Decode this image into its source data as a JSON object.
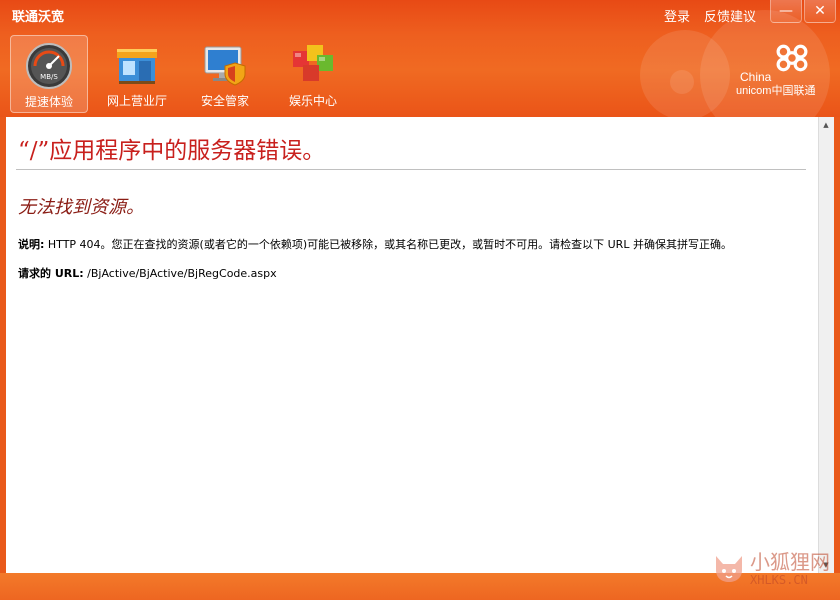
{
  "window": {
    "title": "联通沃宽"
  },
  "header": {
    "links": [
      "登录",
      "反馈建议"
    ],
    "controls": {
      "minimize": "—",
      "close": "✕"
    }
  },
  "toolbar": {
    "items": [
      {
        "label": "提速体验",
        "icon": "speedometer-icon",
        "active": true,
        "badge": "MB/S"
      },
      {
        "label": "网上营业厅",
        "icon": "store-icon",
        "active": false
      },
      {
        "label": "安全管家",
        "icon": "shield-monitor-icon",
        "active": false
      },
      {
        "label": "娱乐中心",
        "icon": "cubes-icon",
        "active": false
      }
    ]
  },
  "brand": {
    "line1": "China",
    "line2": "unicom中国联通"
  },
  "page": {
    "error_title": "“/”应用程序中的服务器错误。",
    "error_subtitle": "无法找到资源。",
    "description_label": "说明:",
    "description_text": " HTTP 404。您正在查找的资源(或者它的一个依赖项)可能已被移除，或其名称已更改，或暂时不可用。请检查以下 URL 并确保其拼写正确。",
    "url_label": "请求的 URL:",
    "url_value": " /BjActive/BjActive/BjRegCode.aspx"
  },
  "watermark": {
    "cn": "小狐狸网",
    "en": "XHLKS.CN"
  },
  "colors": {
    "accent": "#ec5a1c",
    "error_title": "#c8201d",
    "error_subtitle": "#8a1c14"
  }
}
